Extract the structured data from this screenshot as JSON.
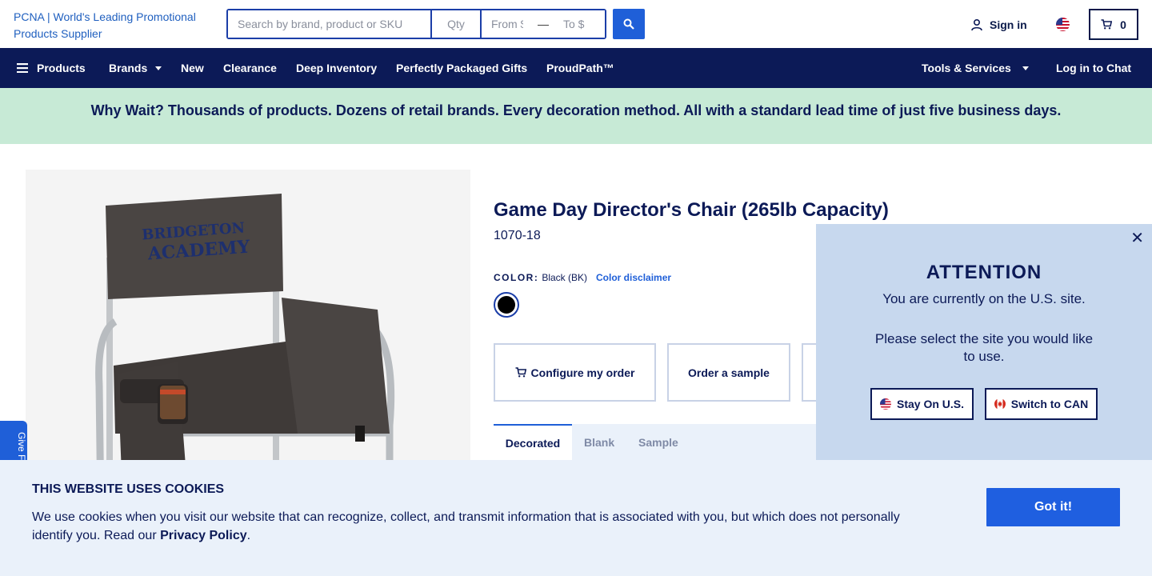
{
  "header": {
    "logo_alt": "PCNA | World's Leading Promotional Products Supplier",
    "search": {
      "placeholder": "Search by brand, product or SKU",
      "qty_placeholder": "Qty",
      "from_placeholder": "From $",
      "dash": "—",
      "to_placeholder": "To $",
      "button_icon": "search-icon"
    },
    "sign_in_label": "Sign in",
    "country_icon": "us-flag-icon",
    "cart_count": "0"
  },
  "nav": {
    "products": "Products",
    "brands": "Brands",
    "new": "New",
    "clearance": "Clearance",
    "deep_inventory": "Deep Inventory",
    "perfectly_packaged": "Perfectly Packaged Gifts",
    "proudpath": "ProudPath™",
    "tools_services": "Tools & Services",
    "log_in_chat": "Log in to Chat"
  },
  "promo": {
    "text": "Why Wait? Thousands of products. Dozens of retail brands. Every decoration method. All with a standard lead time of just five business days."
  },
  "product": {
    "title": "Game Day Director's Chair (265lb Capacity)",
    "sku": "1070-18",
    "color_label": "COLOR:",
    "color_value": "Black (BK)",
    "color_disclaimer": "Color disclaimer",
    "swatch_color": "#000000",
    "image_print": "BRIDGETON ACADEMY",
    "configure_label": "Configure my order",
    "sample_label": "Order a sample",
    "tabs": [
      "Decorated",
      "Blank",
      "Sample"
    ]
  },
  "attention": {
    "title": "ATTENTION",
    "line1": "You are currently on the U.S. site.",
    "line2": "Please select the site you would like to use.",
    "stay_label": "Stay On U.S.",
    "switch_label": "Switch to CAN"
  },
  "feedback": {
    "label": "Give Fe"
  },
  "cookie": {
    "title": "THIS WEBSITE USES COOKIES",
    "text_before": "We use cookies when you visit our website that can recognize, collect, and transmit information that is associated with you, but which does not personally identify you. Read our ",
    "link": "Privacy Policy",
    "text_after": ".",
    "button": "Got it!"
  },
  "colors": {
    "navy": "#0c1a57",
    "accent_blue": "#1f5fd8",
    "promo_green": "#c7ead6",
    "popup_bg": "#c7d8ee",
    "cookie_bg": "#eaf1fa"
  }
}
